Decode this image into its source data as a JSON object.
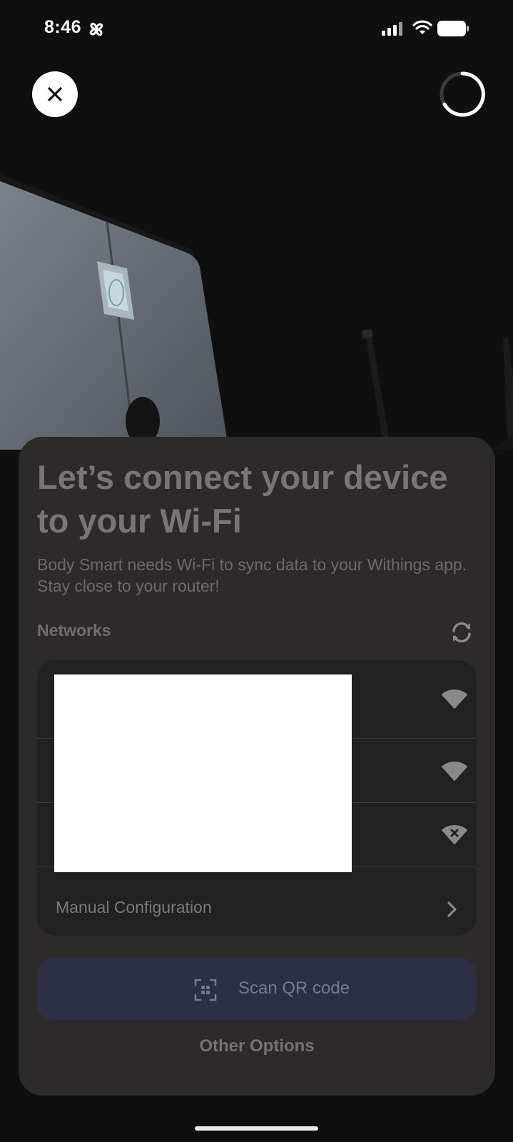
{
  "status_bar": {
    "time": "8:46"
  },
  "header": {
    "close_icon": "close-icon",
    "progress_icon": "loading-spinner"
  },
  "sheet": {
    "title": "Let’s connect your device to your Wi-Fi",
    "subtitle": "Body Smart needs Wi-Fi to sync data to your Withings app. Stay close to your router!",
    "networks_label": "Networks",
    "networks": [
      {
        "signal_icon": "wifi-icon"
      },
      {
        "signal_icon": "wifi-icon"
      },
      {
        "signal_icon": "wifi-off-icon"
      }
    ],
    "manual_configuration_label": "Manual Configuration",
    "scan_qr_label": "Scan QR code",
    "other_options_label": "Other Options"
  },
  "colors": {
    "background": "#0f0f10",
    "sheet": "#2c2b2a",
    "card": "#212121",
    "qr_button": "#2c2f45"
  }
}
